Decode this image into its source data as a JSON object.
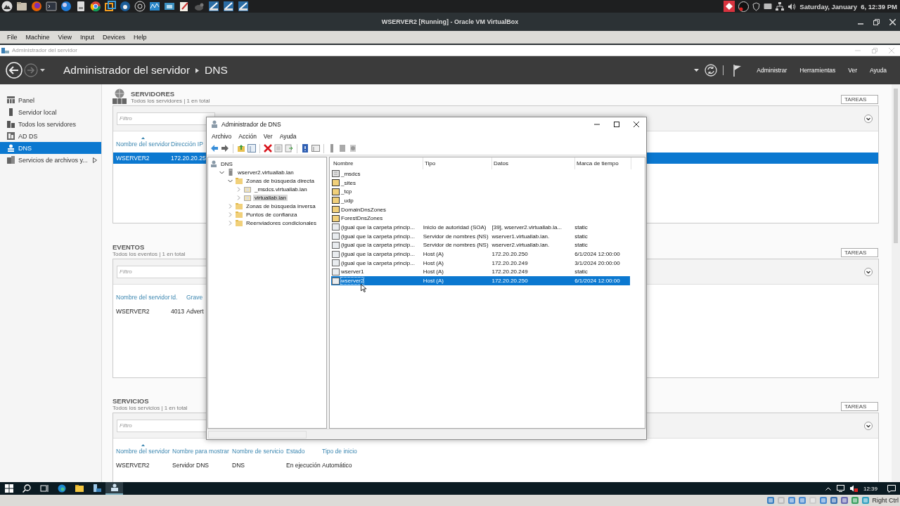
{
  "desktop_bar": {
    "clock": "Saturday, January  6, 12:39 PM"
  },
  "vbox": {
    "title": "WSERVER2 [Running] - Oracle VM VirtualBox",
    "menu": [
      "File",
      "Machine",
      "View",
      "Input",
      "Devices",
      "Help"
    ],
    "host_key": "Right Ctrl"
  },
  "server_manager": {
    "window_title": "Administrador del servidor",
    "breadcrumb": [
      "Administrador del servidor",
      "DNS"
    ],
    "header_menu": [
      "Administrar",
      "Herramientas",
      "Ver",
      "Ayuda"
    ],
    "nav": [
      {
        "label": "Panel",
        "kind": "dashboard",
        "selected": false
      },
      {
        "label": "Servidor local",
        "kind": "server",
        "selected": false
      },
      {
        "label": "Todos los servidores",
        "kind": "servers",
        "selected": false
      },
      {
        "label": "AD DS",
        "kind": "adds",
        "selected": false
      },
      {
        "label": "DNS",
        "kind": "dns",
        "selected": true
      },
      {
        "label": "Servicios de archivos y...",
        "kind": "files",
        "selected": false,
        "submenu": true
      }
    ],
    "sections": [
      {
        "kind": "servers",
        "title": "SERVIDORES",
        "subtitle": "Todos los servidores | 1 en total",
        "tasks": "TAREAS",
        "filter_placeholder": "Filtro",
        "columns": [
          {
            "label": "Nombre del servidor",
            "sorted": true
          },
          {
            "label": "Dirección IP"
          }
        ],
        "rows": [
          {
            "cells": [
              "WSERVER2",
              "172.20.20.25"
            ],
            "selected": true
          }
        ]
      },
      {
        "kind": "events",
        "title": "EVENTOS",
        "subtitle": "Todos los eventos | 1 en total",
        "tasks": "TAREAS",
        "filter_placeholder": "Filtro",
        "columns": [
          {
            "label": "Nombre del servidor"
          },
          {
            "label": "Id."
          },
          {
            "label": "Grave"
          }
        ],
        "rows": [
          {
            "cells": [
              "WSERVER2",
              "4013",
              "Advert"
            ],
            "selected": false
          }
        ]
      },
      {
        "kind": "services",
        "title": "SERVICIOS",
        "subtitle": "Todos los servicios | 1 en total",
        "tasks": "TAREAS",
        "filter_placeholder": "Filtro",
        "columns": [
          {
            "label": "Nombre del servidor",
            "sorted": true
          },
          {
            "label": "Nombre para mostrar"
          },
          {
            "label": "Nombre de servicio"
          },
          {
            "label": "Estado"
          },
          {
            "label": "Tipo de inicio"
          }
        ],
        "rows": [
          {
            "cells": [
              "WSERVER2",
              "Servidor DNS",
              "DNS",
              "En ejecución",
              "Automático"
            ],
            "selected": false
          }
        ]
      }
    ]
  },
  "dns_window": {
    "title": "Administrador de DNS",
    "menu": [
      "Archivo",
      "Acción",
      "Ver",
      "Ayuda"
    ],
    "tree": [
      {
        "label": "DNS",
        "kind": "dns",
        "selected": false,
        "children": [
          {
            "label": "wserver2.virtuallab.lan",
            "kind": "server",
            "selected": false,
            "expanded": true,
            "children": [
              {
                "label": "Zonas de búsqueda directa",
                "kind": "folder",
                "selected": false,
                "expanded": true,
                "children": [
                  {
                    "label": "_msdcs.virtuallab.lan",
                    "kind": "zone",
                    "selected": false,
                    "expanded": false
                  },
                  {
                    "label": "virtuallab.lan",
                    "kind": "zone",
                    "selected": true,
                    "expanded": false
                  }
                ]
              },
              {
                "label": "Zonas de búsqueda inversa",
                "kind": "folder",
                "selected": false,
                "expanded": false
              },
              {
                "label": "Puntos de confianza",
                "kind": "folder",
                "selected": false,
                "expanded": false
              },
              {
                "label": "Reenviadores condicionales",
                "kind": "folder",
                "selected": false,
                "expanded": false
              }
            ]
          }
        ]
      }
    ],
    "columns": [
      "Nombre",
      "Tipo",
      "Datos",
      "Marca de tiempo"
    ],
    "rows": [
      {
        "kind": "delegation",
        "cells": [
          "_msdcs"
        ],
        "selected": false
      },
      {
        "kind": "folder",
        "cells": [
          "_sites"
        ],
        "selected": false
      },
      {
        "kind": "folder",
        "cells": [
          "_tcp"
        ],
        "selected": false
      },
      {
        "kind": "folder",
        "cells": [
          "_udp"
        ],
        "selected": false
      },
      {
        "kind": "folder",
        "cells": [
          "DomainDnsZones"
        ],
        "selected": false
      },
      {
        "kind": "folder",
        "cells": [
          "ForestDnsZones"
        ],
        "selected": false
      },
      {
        "kind": "record",
        "cells": [
          "(igual que la carpeta princip...",
          "Inicio de autoridad (SOA)",
          "[39], wserver2.virtuallab.la...",
          "static"
        ],
        "selected": false
      },
      {
        "kind": "record",
        "cells": [
          "(igual que la carpeta princip...",
          "Servidor de nombres (NS)",
          "wserver1.virtuallab.lan.",
          "static"
        ],
        "selected": false
      },
      {
        "kind": "record",
        "cells": [
          "(igual que la carpeta princip...",
          "Servidor de nombres (NS)",
          "wserver2.virtuallab.lan.",
          "static"
        ],
        "selected": false
      },
      {
        "kind": "record",
        "cells": [
          "(igual que la carpeta princip...",
          "Host (A)",
          "172.20.20.250",
          "6/1/2024 12:00:00"
        ],
        "selected": false
      },
      {
        "kind": "record",
        "cells": [
          "(igual que la carpeta princip...",
          "Host (A)",
          "172.20.20.249",
          "3/1/2024 20:00:00"
        ],
        "selected": false
      },
      {
        "kind": "record",
        "cells": [
          "wserver1",
          "Host (A)",
          "172.20.20.249",
          "static"
        ],
        "selected": false
      },
      {
        "kind": "record",
        "cells": [
          "wserver2",
          "Host (A)",
          "172.20.20.250",
          "6/1/2024 12:00:00"
        ],
        "selected": true
      }
    ]
  },
  "taskbar": {
    "clock": "12:39"
  }
}
